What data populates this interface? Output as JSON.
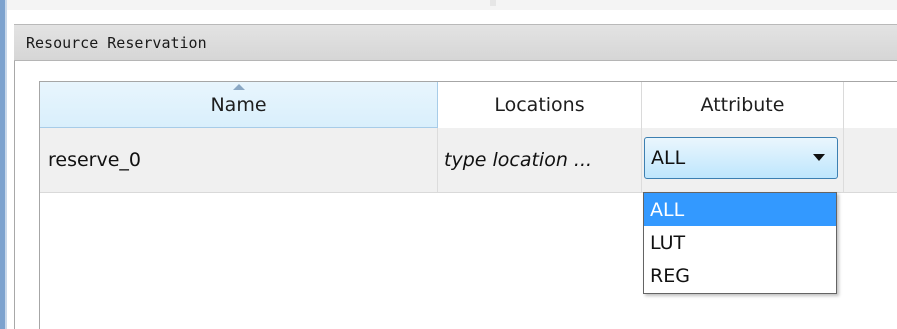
{
  "panel": {
    "title": "Resource Reservation"
  },
  "table": {
    "columns": [
      {
        "label": "Name",
        "sorted": true
      },
      {
        "label": "Locations"
      },
      {
        "label": "Attribute"
      }
    ],
    "rows": [
      {
        "name": "reserve_0",
        "locations": "type location ...",
        "attribute": "ALL"
      }
    ]
  },
  "attribute_dropdown": {
    "selected": "ALL",
    "options": [
      "ALL",
      "LUT",
      "REG"
    ],
    "expanded": true
  },
  "colors": {
    "selection": "#3399ff",
    "header_sorted_bg": "#d9effc",
    "accent_bar": "#7da2ce"
  }
}
